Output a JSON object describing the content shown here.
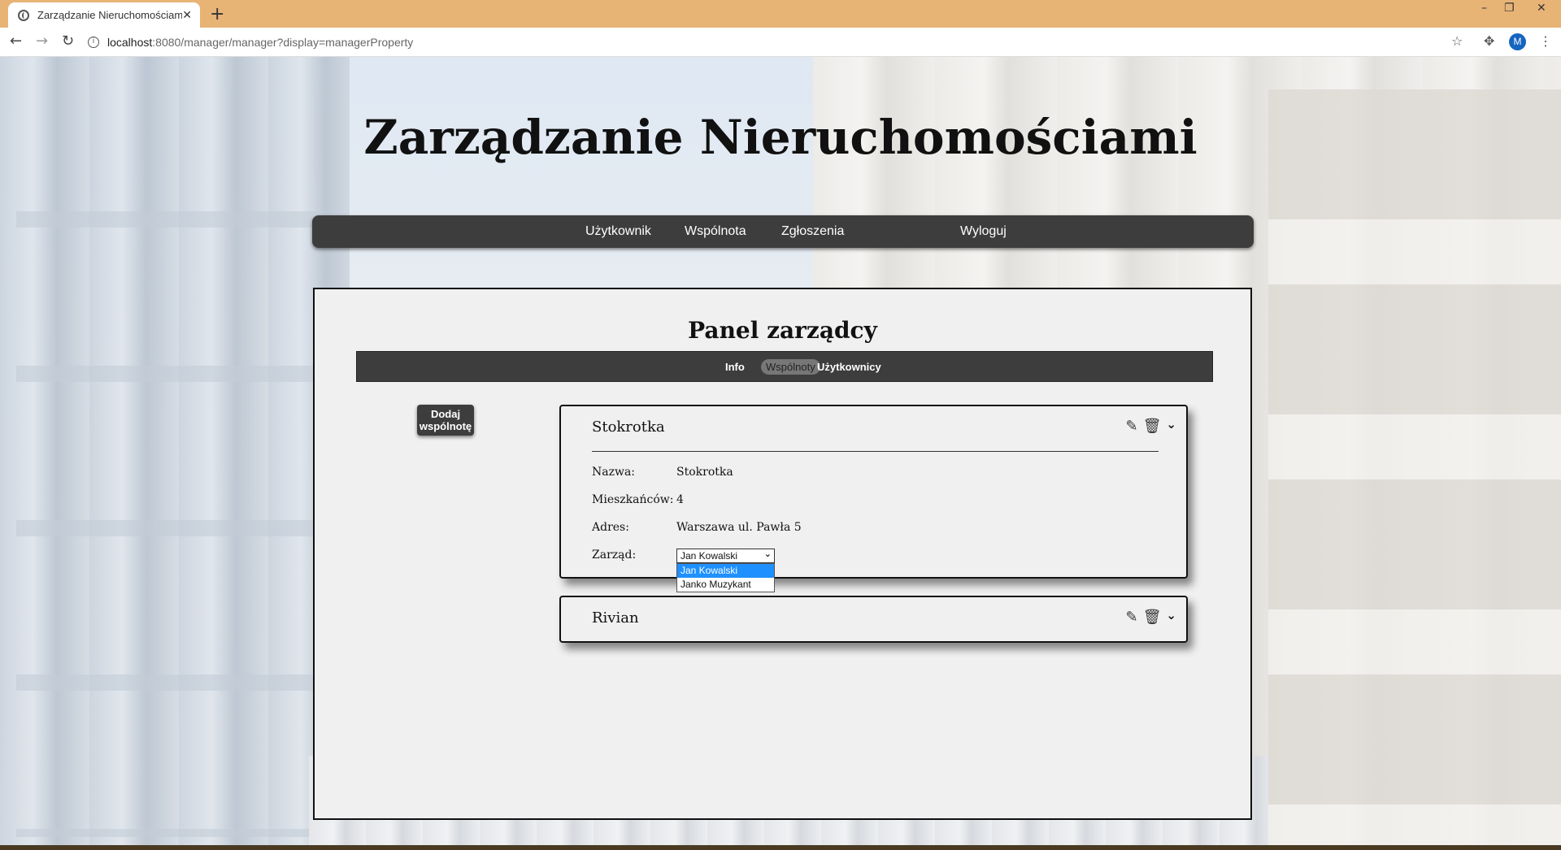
{
  "browser": {
    "tab_title": "Zarządzanie Nieruchomościami",
    "tab_close": "✕",
    "new_tab": "+",
    "url_host": "localhost",
    "url_rest": ":8080/manager/manager?display=managerProperty",
    "avatar_letter": "M",
    "icons": [
      "back-icon",
      "forward-icon",
      "reload-icon",
      "info-icon",
      "star-icon",
      "extensions-icon",
      "menu-icon",
      "minimize-icon",
      "restore-icon",
      "close-icon"
    ]
  },
  "site": {
    "title": "Zarządzanie Nieruchomościami"
  },
  "main_nav": {
    "items": [
      "Użytkownik",
      "Wspólnota",
      "Zgłoszenia",
      "Wyloguj"
    ]
  },
  "panel": {
    "title": "Panel zarządcy",
    "subnav": [
      "Info",
      "Wspólnoty",
      "Użytkownicy"
    ],
    "subnav_active": "Wspólnoty",
    "add_button": [
      "Dodaj",
      "wspólnotę"
    ]
  },
  "communities": [
    {
      "name": "Stokrotka",
      "expanded": true,
      "details": [
        {
          "label": "Nazwa:",
          "value": "Stokrotka"
        },
        {
          "label": "Mieszkańców:",
          "value": "4"
        },
        {
          "label": "Adres:",
          "value": "Warszawa ul. Pawła 5"
        }
      ],
      "board_label": "Zarząd:",
      "board_selected": "Jan Kowalski",
      "board_options": [
        "Jan Kowalski",
        "Janko Muzykant"
      ],
      "dropdown_open": true
    },
    {
      "name": "Rivian",
      "expanded": false
    }
  ],
  "colors": {
    "nav_bg": "#3d3d3d",
    "tabbar": "#e8b476",
    "option_highlight": "#1e90ff"
  }
}
